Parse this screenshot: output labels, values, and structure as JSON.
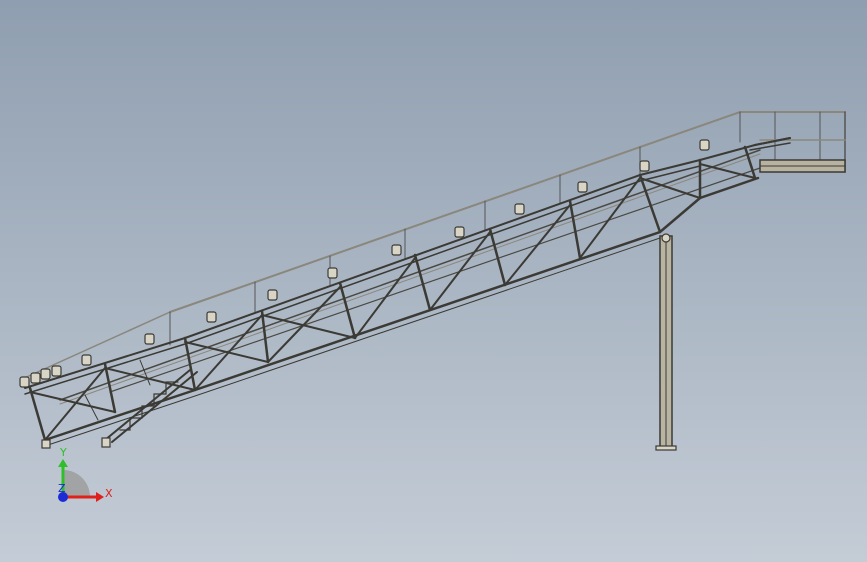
{
  "viewport": {
    "background_top": "#8f9eb0",
    "background_bottom": "#c4ccd6"
  },
  "model": {
    "description_icon": "conveyor-truss-model-icon",
    "frame_color": "#3b3a35",
    "frame_fill": "#bdb8a6",
    "rail_color": "#7a7870"
  },
  "triad": {
    "x_label": "X",
    "y_label": "Y",
    "z_label": "Z",
    "x_color": "#e0201a",
    "y_color": "#2fbf2a",
    "z_color": "#1d2bd6"
  }
}
